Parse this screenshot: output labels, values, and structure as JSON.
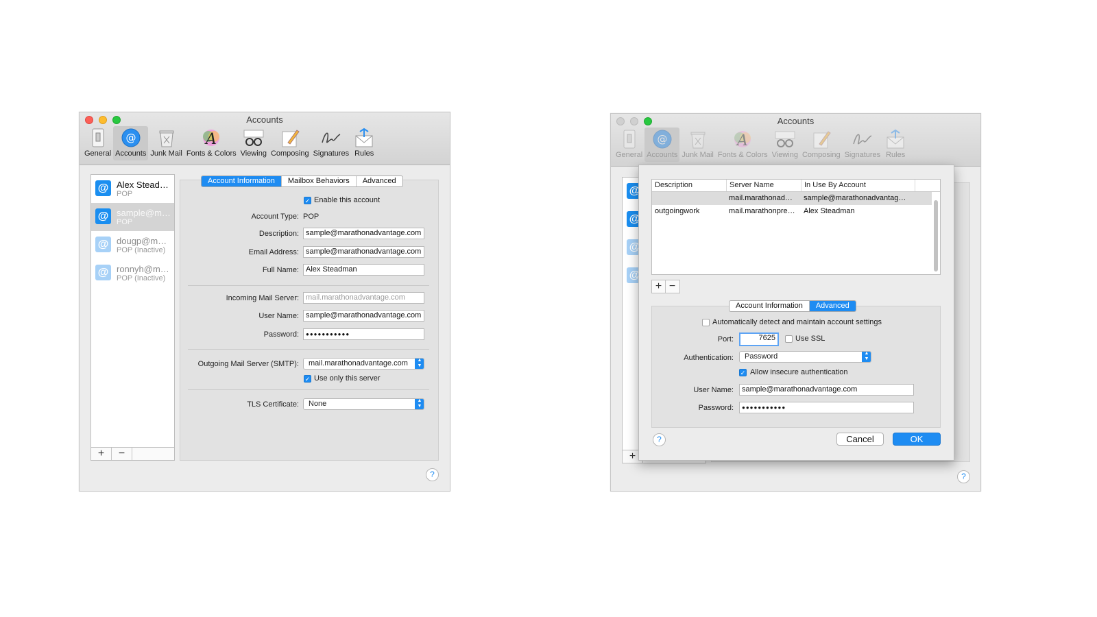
{
  "left_window": {
    "title": "Accounts",
    "toolbar": [
      {
        "label": "General",
        "icon": "switch-icon"
      },
      {
        "label": "Accounts",
        "icon": "at-sign-icon"
      },
      {
        "label": "Junk Mail",
        "icon": "trash-bin-icon"
      },
      {
        "label": "Fonts & Colors",
        "icon": "font-icon"
      },
      {
        "label": "Viewing",
        "icon": "glasses-icon"
      },
      {
        "label": "Composing",
        "icon": "pencil-icon"
      },
      {
        "label": "Signatures",
        "icon": "signature-icon"
      },
      {
        "label": "Rules",
        "icon": "envelope-icon"
      }
    ],
    "accounts": [
      {
        "name": "Alex Stead…",
        "type": "POP"
      },
      {
        "name": "sample@m…",
        "type": "POP"
      },
      {
        "name": "dougp@m…",
        "type": "POP (Inactive)"
      },
      {
        "name": "ronnyh@m…",
        "type": "POP (Inactive)"
      }
    ],
    "tabs": [
      "Account Information",
      "Mailbox Behaviors",
      "Advanced"
    ],
    "enable_account_label": "Enable this account",
    "account_type_label": "Account Type:",
    "account_type_value": "POP",
    "description_label": "Description:",
    "description_value": "sample@marathonadvantage.com",
    "email_label": "Email Address:",
    "email_value": "sample@marathonadvantage.com",
    "fullname_label": "Full Name:",
    "fullname_value": "Alex Steadman",
    "incoming_label": "Incoming Mail Server:",
    "incoming_value": "mail.marathonadvantage.com",
    "username_label": "User Name:",
    "username_value": "sample@marathonadvantage.com",
    "password_label": "Password:",
    "password_value": "●●●●●●●●●●●",
    "smtp_label": "Outgoing Mail Server (SMTP):",
    "smtp_value": "mail.marathonadvantage.com",
    "use_only_label": "Use only this server",
    "tls_label": "TLS Certificate:",
    "tls_value": "None",
    "help": "?"
  },
  "right_window": {
    "title": "Accounts",
    "toolbar": [
      {
        "label": "General"
      },
      {
        "label": "Accounts"
      },
      {
        "label": "Junk Mail"
      },
      {
        "label": "Fonts & Colors"
      },
      {
        "label": "Viewing"
      },
      {
        "label": "Composing"
      },
      {
        "label": "Signatures"
      },
      {
        "label": "Rules"
      }
    ],
    "table": {
      "headers": [
        "Description",
        "Server Name",
        "In Use By Account"
      ],
      "rows": [
        [
          "",
          "mail.marathonad…",
          "sample@marathonadvantag…"
        ],
        [
          "outgoingwork",
          "mail.marathonpre…",
          "Alex Steadman"
        ]
      ]
    },
    "tabs": [
      "Account Information",
      "Advanced"
    ],
    "auto_detect_label": "Automatically detect and maintain account settings",
    "port_label": "Port:",
    "port_value": "7625",
    "use_ssl_label": "Use SSL",
    "auth_label": "Authentication:",
    "auth_value": "Password",
    "allow_insecure_label": "Allow insecure authentication",
    "username_label": "User Name:",
    "username_value": "sample@marathonadvantage.com",
    "password_label": "Password:",
    "password_value": "●●●●●●●●●●●",
    "cancel_label": "Cancel",
    "ok_label": "OK",
    "help": "?"
  },
  "colors": {
    "accent": "#1e8cf2",
    "window_bg": "#ececec"
  }
}
